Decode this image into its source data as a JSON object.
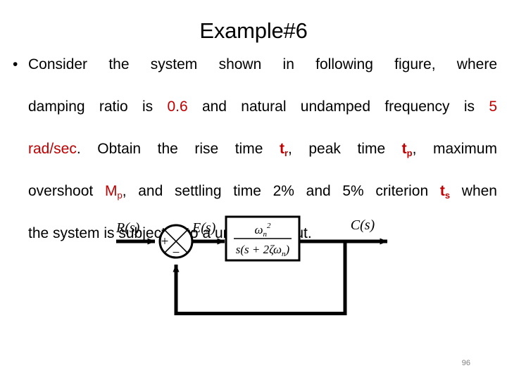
{
  "slide": {
    "title": "Example#6",
    "page_number": "96",
    "colors": {
      "background": "#ffffff",
      "text": "#000000",
      "accent_red": "#c00000",
      "page_number": "#808080"
    }
  },
  "body": {
    "bullet_marker": "•",
    "lines": [
      {
        "id": "line1",
        "justified": true,
        "plain": "Consider the system shown in following figure, where",
        "runs": [
          {
            "text": "Consider the system shown in following figure, where",
            "style": "normal"
          }
        ]
      },
      {
        "id": "line2",
        "justified": true,
        "plain": "damping ratio is 0.6 and natural undamped frequency is 5",
        "runs": [
          {
            "text": "damping ratio is ",
            "style": "normal"
          },
          {
            "text": "0.6",
            "style": "red"
          },
          {
            "text": " and natural undamped frequency is ",
            "style": "normal"
          },
          {
            "text": "5",
            "style": "red"
          }
        ]
      },
      {
        "id": "line3",
        "justified": true,
        "plain": "rad/sec. Obtain the rise time tr, peak time tp, maximum",
        "runs": [
          {
            "text": "rad/sec",
            "style": "red"
          },
          {
            "text": ". Obtain the rise time ",
            "style": "normal"
          },
          {
            "text": "t",
            "sub": "r",
            "style": "red-bold"
          },
          {
            "text": ", peak time ",
            "style": "normal"
          },
          {
            "text": "t",
            "sub": "p",
            "style": "red-bold"
          },
          {
            "text": ", maximum",
            "style": "normal"
          }
        ]
      },
      {
        "id": "line4",
        "justified": true,
        "plain": "overshoot Mp, and settling time 2% and 5% criterion ts when",
        "runs": [
          {
            "text": "overshoot ",
            "style": "normal"
          },
          {
            "text": "M",
            "sub": "p",
            "style": "red"
          },
          {
            "text": ", and settling time 2% and 5% criterion ",
            "style": "normal"
          },
          {
            "text": "t",
            "sub": "s",
            "style": "red-bold"
          },
          {
            "text": " when",
            "style": "normal"
          }
        ]
      },
      {
        "id": "line5",
        "justified": false,
        "plain": "the system is subjected to a unit-step input.",
        "runs": [
          {
            "text": "the system is subjected to a unit-step input.",
            "style": "normal"
          }
        ]
      }
    ]
  },
  "diagram": {
    "type": "control-system-block-diagram",
    "description": "Unity negative feedback closed-loop system",
    "labels": {
      "input": "R(s)",
      "error": "E(s)",
      "output": "C(s)",
      "summing_plus": "+",
      "summing_minus": "−"
    },
    "transfer_function": {
      "numerator": "ωn2",
      "numerator_base": "ω",
      "numerator_sub": "n",
      "numerator_sup": "2",
      "denominator": "s(s + 2ζωn)",
      "denominator_prefix": "s(s + 2ζω",
      "denominator_sub": "n",
      "denominator_suffix": ")"
    },
    "feedback": {
      "gain": "1",
      "sign": "negative",
      "unity": true
    }
  }
}
